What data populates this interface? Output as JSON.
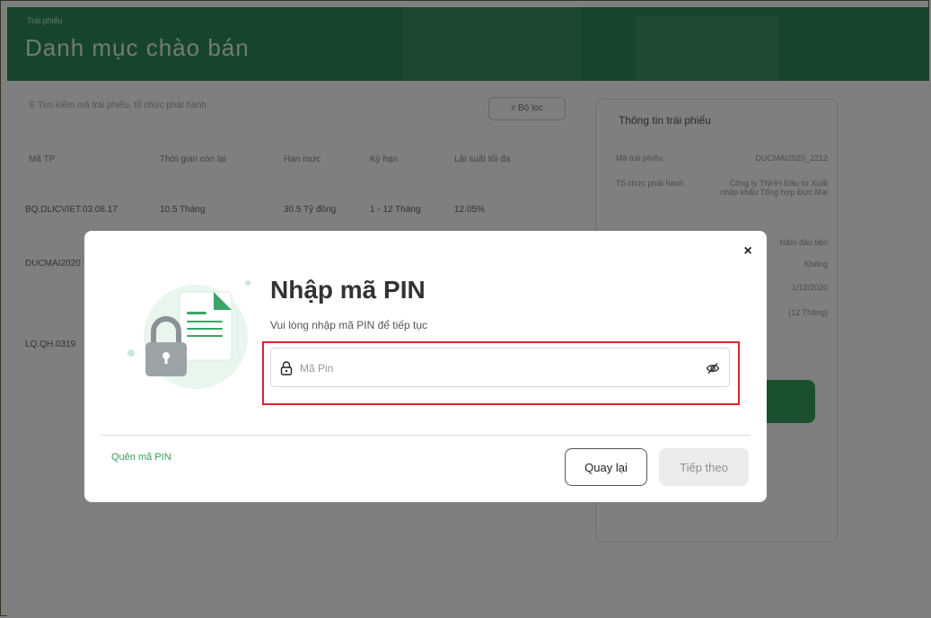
{
  "background": {
    "breadcrumb": "Trái phiếu",
    "page_title": "Danh mục chào bán",
    "search_placeholder": "Tìm kiếm mã trái phiếu, tổ chức phát hành",
    "filter_label": "Bộ lọc",
    "table": {
      "headers": [
        "Mã TP",
        "Thời gian còn lại",
        "Hạn mức",
        "Kỳ hạn",
        "Lãi suất tối đa"
      ],
      "rows": [
        [
          "BQ.DLICVIET.03.08.17",
          "10.5 Tháng",
          "30.5 Tỷ đồng",
          "1 - 12 Tháng",
          "12.05%"
        ],
        [
          "DUCMAI2020",
          "",
          "",
          "",
          ""
        ],
        [
          "LQ.QH.0319",
          "",
          "",
          "",
          ""
        ]
      ]
    },
    "side_panel": {
      "title": "Thông tin trái phiếu",
      "rows": [
        {
          "label": "Mã trái phiếu",
          "value": "DUCMAI2020_2212"
        },
        {
          "label": "Tổ chức phát hành",
          "value": "Công ty TNHH Đầu tư Xuất nhập khẩu Tổng hợp Đức Mai"
        },
        {
          "label": "",
          "value": "Năm đầu tiên"
        },
        {
          "label": "",
          "value": "Không"
        },
        {
          "label": "",
          "value": "1/12/2020"
        },
        {
          "label": "",
          "value": "(12 Tháng)"
        }
      ]
    },
    "colors": {
      "header_green": "#2e8b57",
      "accent_green": "#2f9d57"
    }
  },
  "modal": {
    "title": "Nhập mã PIN",
    "subtitle": "Vui lòng nhập mã PIN để tiếp tục",
    "pin_placeholder": "Mã Pin",
    "pin_value": "",
    "forgot_label": "Quên mã PIN",
    "back_label": "Quay lại",
    "next_label": "Tiếp theo",
    "close_label": "×",
    "icons": {
      "lock": "lock-icon",
      "eye_off": "eye-off-icon",
      "illustration": "document-lock-illustration"
    },
    "colors": {
      "highlight": "#e0242a",
      "link": "#2f9d57",
      "next_bg": "#ececec"
    }
  }
}
